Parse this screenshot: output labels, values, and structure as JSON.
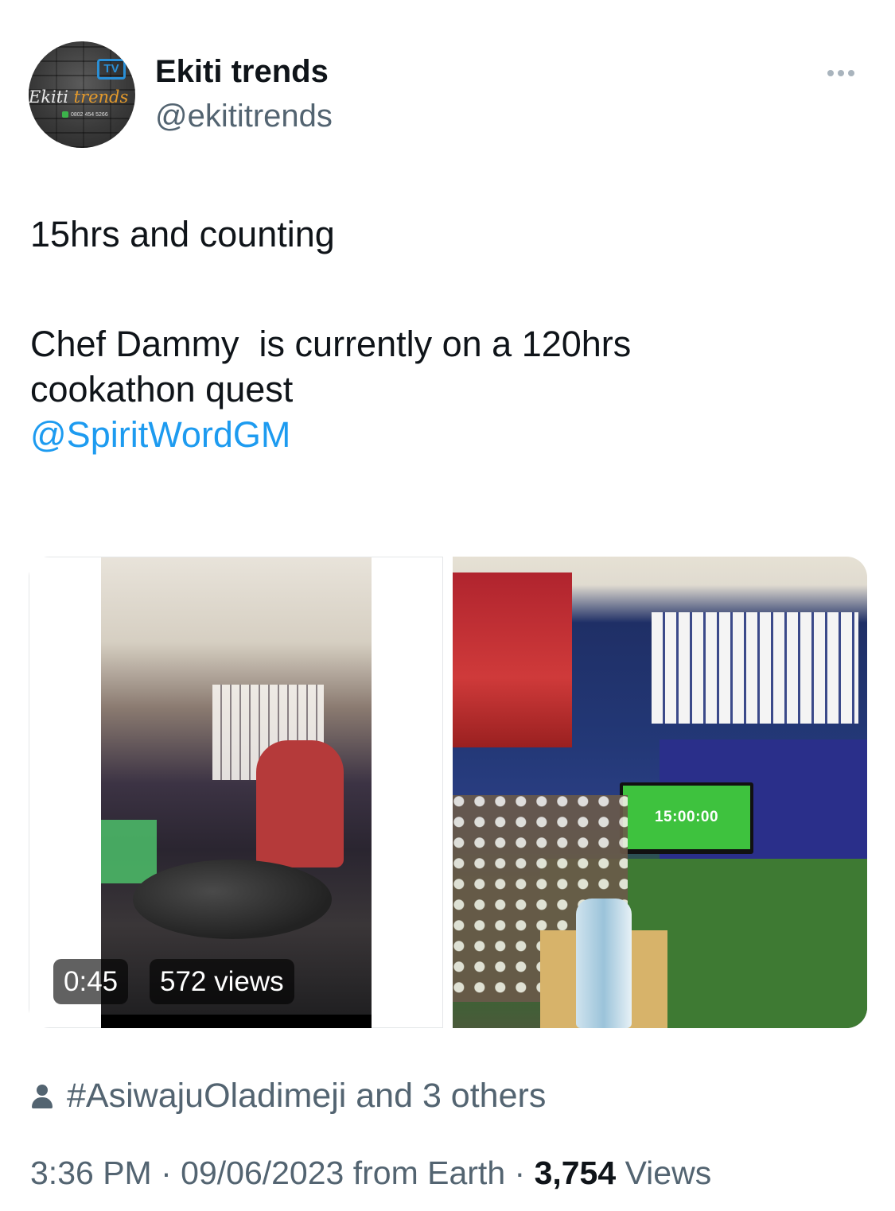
{
  "author": {
    "display_name": "Ekiti trends",
    "handle": "@ekititrends",
    "avatar_text": {
      "tv": "TV",
      "brand_a": "Ekiti",
      "brand_b": "trends",
      "phone": "0802 454 5266"
    }
  },
  "tweet": {
    "line1": "15hrs and counting",
    "line2": "Chef Dammy  is currently on a 120hrs cookathon quest",
    "mention": "@SpiritWordGM"
  },
  "media": {
    "video": {
      "duration": "0:45",
      "views": "572 views"
    },
    "photo": {
      "screen_text": "15:00:00"
    }
  },
  "topic": {
    "icon": "person-icon",
    "text": "#AsiwajuOladimeji and 3 others"
  },
  "meta": {
    "time": "3:36 PM",
    "sep1": " · ",
    "date": "09/06/2023",
    "source": " from Earth",
    "sep2": " · ",
    "views_count": "3,754",
    "views_label": " Views"
  },
  "colors": {
    "link": "#1d9bf0",
    "secondary": "#536471",
    "primary": "#0f1419"
  }
}
